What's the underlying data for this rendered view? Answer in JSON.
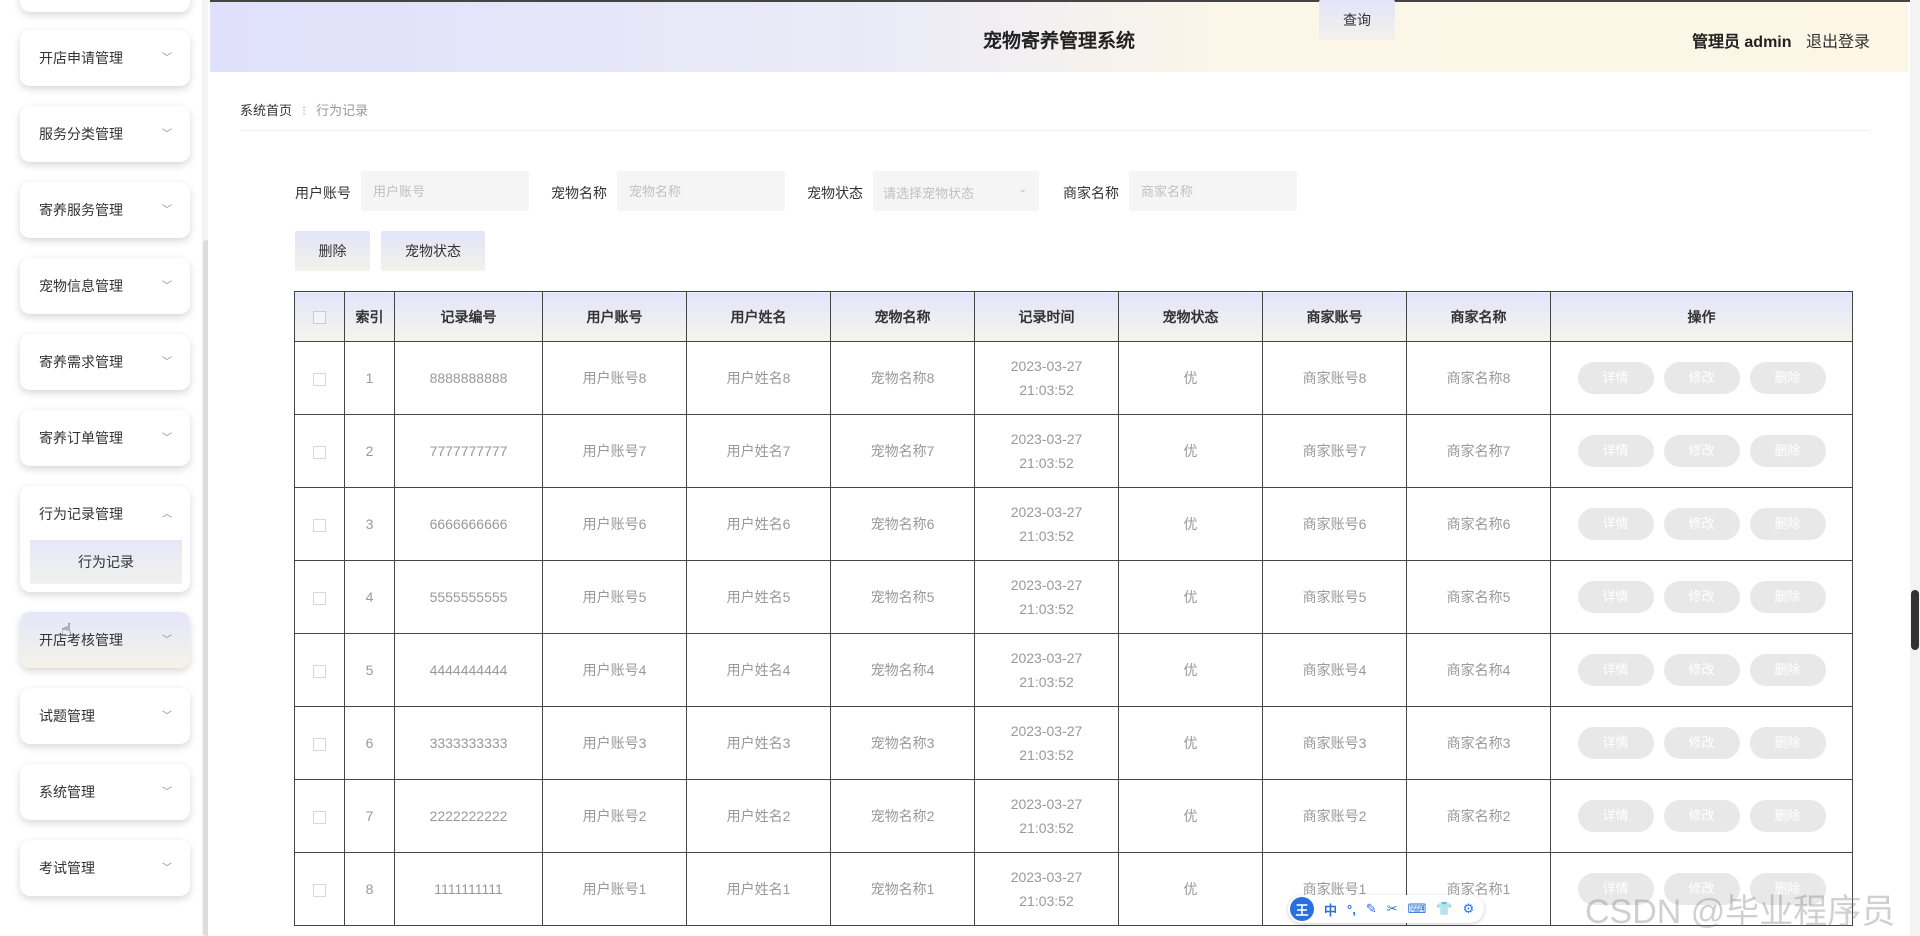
{
  "app": {
    "title": "宠物寄养管理系统",
    "user_role": "管理员 admin",
    "logout": "退出登录"
  },
  "sidebar": {
    "items": [
      {
        "label": "开店申请管理"
      },
      {
        "label": "服务分类管理"
      },
      {
        "label": "寄养服务管理"
      },
      {
        "label": "宠物信息管理"
      },
      {
        "label": "寄养需求管理"
      },
      {
        "label": "寄养订单管理"
      },
      {
        "label": "行为记录管理",
        "open": true,
        "sub": "行为记录"
      },
      {
        "label": "开店考核管理"
      },
      {
        "label": "试题管理"
      },
      {
        "label": "系统管理"
      },
      {
        "label": "考试管理"
      }
    ]
  },
  "breadcrumb": {
    "home": "系统首页",
    "current": "行为记录"
  },
  "search": {
    "user_account_label": "用户账号",
    "user_account_placeholder": "用户账号",
    "pet_name_label": "宠物名称",
    "pet_name_placeholder": "宠物名称",
    "pet_status_label": "宠物状态",
    "pet_status_placeholder": "请选择宠物状态",
    "merchant_name_label": "商家名称",
    "merchant_name_placeholder": "商家名称",
    "query_button": "查询"
  },
  "actions": {
    "delete": "删除",
    "pet_status": "宠物状态"
  },
  "table": {
    "headers": [
      "索引",
      "记录编号",
      "用户账号",
      "用户姓名",
      "宠物名称",
      "记录时间",
      "宠物状态",
      "商家账号",
      "商家名称",
      "操作"
    ],
    "op_labels": {
      "detail": "详情",
      "edit": "修改",
      "delete": "删除"
    },
    "rows": [
      {
        "index": "1",
        "record_no": "8888888888",
        "user_account": "用户账号8",
        "user_name": "用户姓名8",
        "pet_name": "宠物名称8",
        "time": "2023-03-27 21:03:52",
        "status": "优",
        "merchant_account": "商家账号8",
        "merchant_name": "商家名称8"
      },
      {
        "index": "2",
        "record_no": "7777777777",
        "user_account": "用户账号7",
        "user_name": "用户姓名7",
        "pet_name": "宠物名称7",
        "time": "2023-03-27 21:03:52",
        "status": "优",
        "merchant_account": "商家账号7",
        "merchant_name": "商家名称7"
      },
      {
        "index": "3",
        "record_no": "6666666666",
        "user_account": "用户账号6",
        "user_name": "用户姓名6",
        "pet_name": "宠物名称6",
        "time": "2023-03-27 21:03:52",
        "status": "优",
        "merchant_account": "商家账号6",
        "merchant_name": "商家名称6"
      },
      {
        "index": "4",
        "record_no": "5555555555",
        "user_account": "用户账号5",
        "user_name": "用户姓名5",
        "pet_name": "宠物名称5",
        "time": "2023-03-27 21:03:52",
        "status": "优",
        "merchant_account": "商家账号5",
        "merchant_name": "商家名称5"
      },
      {
        "index": "5",
        "record_no": "4444444444",
        "user_account": "用户账号4",
        "user_name": "用户姓名4",
        "pet_name": "宠物名称4",
        "time": "2023-03-27 21:03:52",
        "status": "优",
        "merchant_account": "商家账号4",
        "merchant_name": "商家名称4"
      },
      {
        "index": "6",
        "record_no": "3333333333",
        "user_account": "用户账号3",
        "user_name": "用户姓名3",
        "pet_name": "宠物名称3",
        "time": "2023-03-27 21:03:52",
        "status": "优",
        "merchant_account": "商家账号3",
        "merchant_name": "商家名称3"
      },
      {
        "index": "7",
        "record_no": "2222222222",
        "user_account": "用户账号2",
        "user_name": "用户姓名2",
        "pet_name": "宠物名称2",
        "time": "2023-03-27 21:03:52",
        "status": "优",
        "merchant_account": "商家账号2",
        "merchant_name": "商家名称2"
      },
      {
        "index": "8",
        "record_no": "1111111111",
        "user_account": "用户账号1",
        "user_name": "用户姓名1",
        "pet_name": "宠物名称1",
        "time": "2023-03-27 21:03:52",
        "status": "优",
        "merchant_account": "商家账号1",
        "merchant_name": "商家名称1"
      }
    ]
  },
  "ime": {
    "logo": "王",
    "mode": "中"
  },
  "watermark": "CSDN @毕业程序员"
}
